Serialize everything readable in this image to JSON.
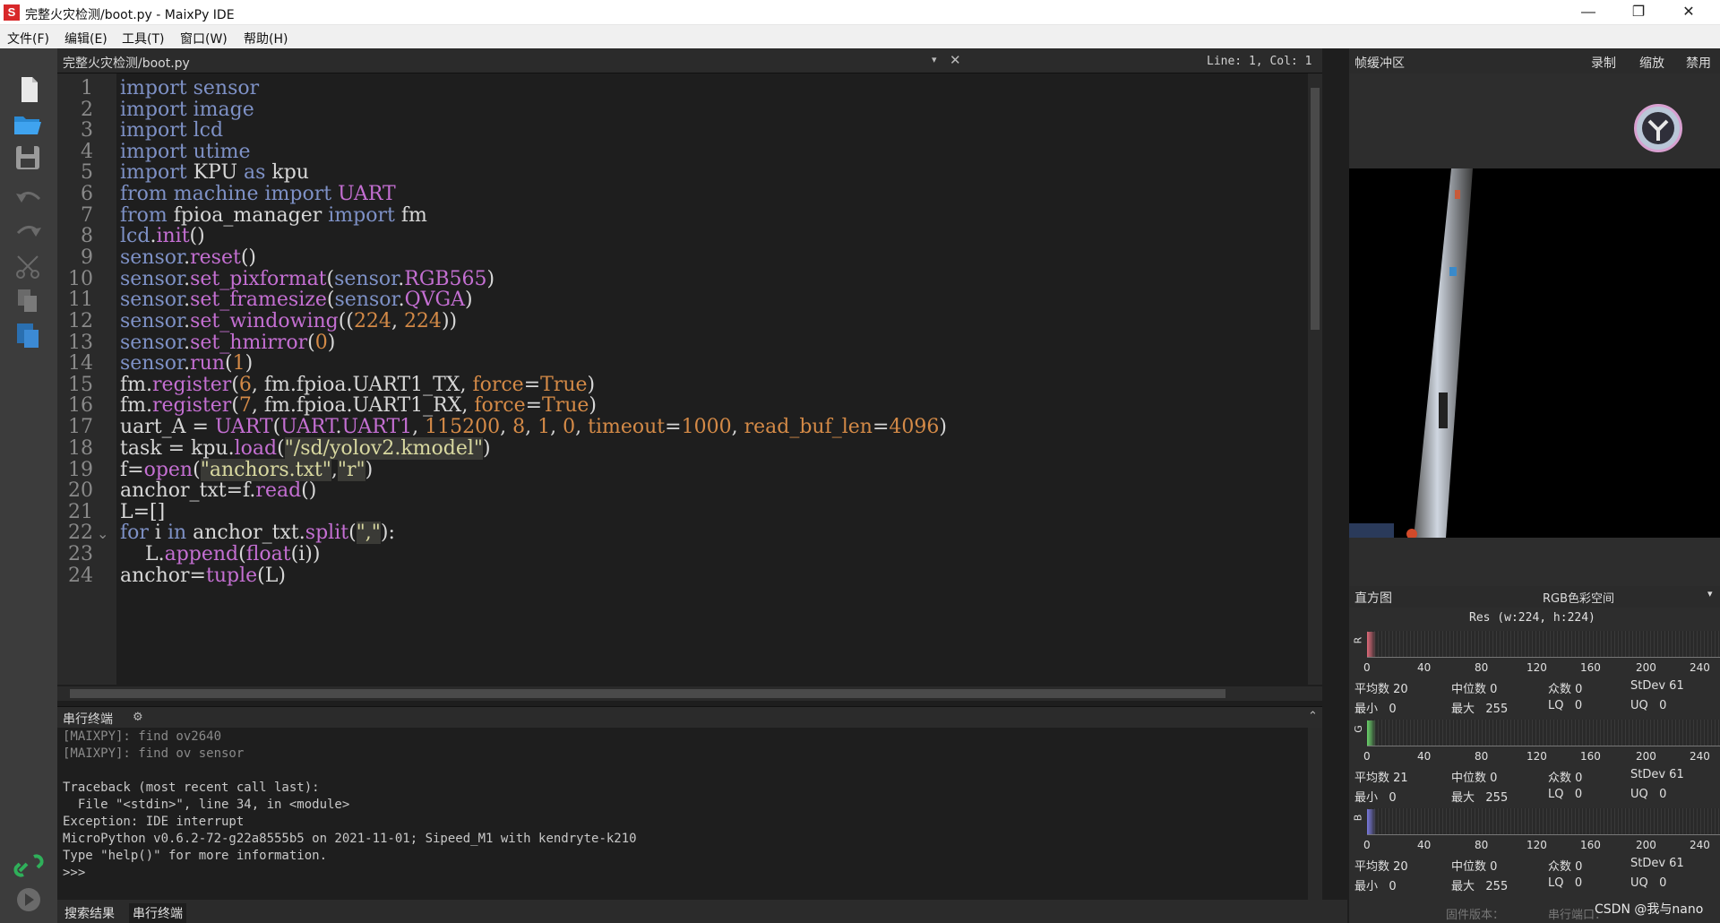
{
  "window": {
    "title": "完整火灾检测/boot.py - MaixPy IDE",
    "icon_letter": "S",
    "controls": [
      "—",
      "❐",
      "✕"
    ]
  },
  "menu": [
    {
      "label": "文件(F)"
    },
    {
      "label": "编辑(E)"
    },
    {
      "label": "工具(T)"
    },
    {
      "label": "窗口(W)"
    },
    {
      "label": "帮助(H)"
    }
  ],
  "toolbar": {
    "icons": [
      "new-file-icon",
      "open-folder-icon",
      "save-icon",
      "undo-icon",
      "redo-icon",
      "cut-icon",
      "copy-icon",
      "paste-icon",
      "connect-icon",
      "run-icon"
    ]
  },
  "editor": {
    "tab_label": "完整火灾检测/boot.py",
    "cursor_position": "Line: 1, Col: 1",
    "line_numbers": [
      "1",
      "2",
      "3",
      "4",
      "5",
      "6",
      "7",
      "8",
      "9",
      "10",
      "11",
      "12",
      "13",
      "14",
      "15",
      "16",
      "17",
      "18",
      "19",
      "20",
      "21",
      "22",
      "23",
      "24"
    ],
    "fold_marker": "⌄"
  },
  "terminal": {
    "title": "串行终端",
    "lines": [
      "[MAIXPY]: find ov2640",
      "[MAIXPY]: find ov sensor",
      "",
      "Traceback (most recent call last):",
      "  File \"<stdin>\", line 34, in <module>",
      "Exception: IDE interrupt",
      "MicroPython v0.6.2-72-g22a8555b5 on 2021-11-01; Sipeed_M1 with kendryte-k210",
      "Type \"help()\" for more information.",
      ">>>"
    ]
  },
  "bottom_tabs": [
    "搜索结果",
    "串行终端"
  ],
  "frame_buffer": {
    "title": "帧缓冲区",
    "record_label": "录制",
    "zoom_label": "缩放",
    "disable_label": "禁用"
  },
  "histogram": {
    "title": "直方图",
    "color_space": "RGB色彩空间",
    "resolution": "Res (w:224, h:224)",
    "ticks": [
      "0",
      "40",
      "80",
      "120",
      "160",
      "200",
      "240"
    ],
    "channels": [
      {
        "name": "R",
        "color": "#e06a7a",
        "mean": "平均数 20",
        "median": "中位数 0",
        "mode": "众数 0",
        "stdev": "StDev 61",
        "min": "最小   0",
        "max": "最大   255",
        "lq": "LQ   0",
        "uq": "UQ   0"
      },
      {
        "name": "G",
        "color": "#6ad46a",
        "mean": "平均数 21",
        "median": "中位数 0",
        "mode": "众数 0",
        "stdev": "StDev 61",
        "min": "最小   0",
        "max": "最大   255",
        "lq": "LQ   0",
        "uq": "UQ   0"
      },
      {
        "name": "B",
        "color": "#7a7ae0",
        "mean": "平均数 20",
        "median": "中位数 0",
        "mode": "众数 0",
        "stdev": "StDev 61",
        "min": "最小   0",
        "max": "最大   255",
        "lq": "LQ   0",
        "uq": "UQ   0"
      }
    ]
  },
  "status": {
    "firmware": "固件版本：",
    "serial": "串行端口：",
    "watermark": "CSDN @我与nano"
  }
}
